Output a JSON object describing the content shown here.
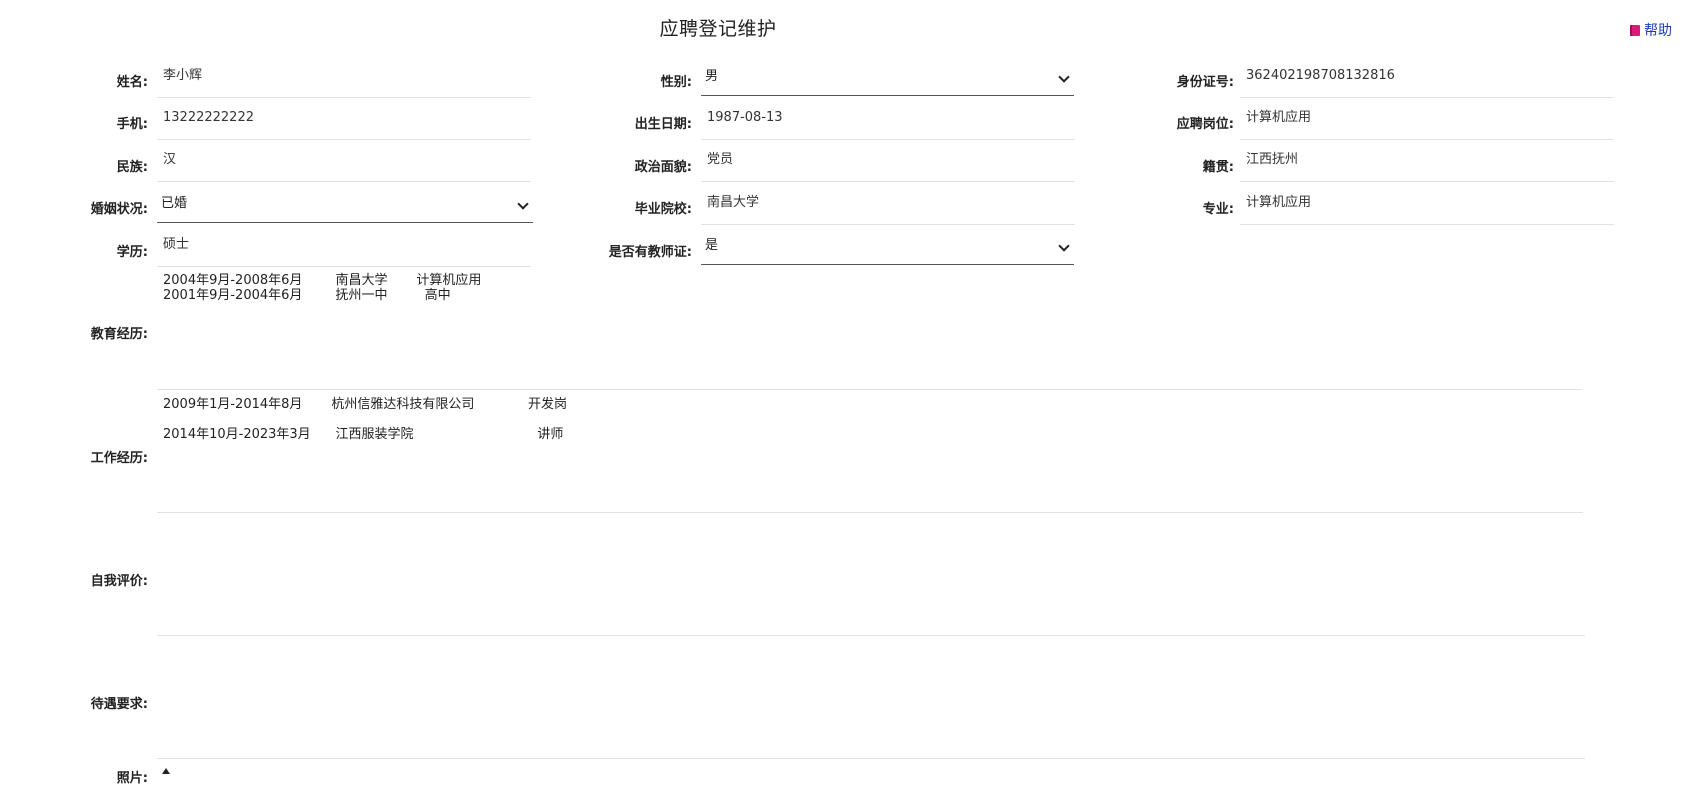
{
  "header": {
    "title": "应聘登记维护",
    "help_label": "帮助"
  },
  "fields": {
    "name": {
      "label": "姓名:",
      "value": "李小辉"
    },
    "gender": {
      "label": "性别:",
      "value": "男"
    },
    "id_card": {
      "label": "身份证号:",
      "value": "362402198708132816"
    },
    "phone": {
      "label": "手机:",
      "value": "13222222222"
    },
    "birth_date": {
      "label": "出生日期:",
      "value": "1987-08-13"
    },
    "position": {
      "label": "应聘岗位:",
      "value": "计算机应用"
    },
    "ethnicity": {
      "label": "民族:",
      "value": "汉"
    },
    "political": {
      "label": "政治面貌:",
      "value": "党员"
    },
    "native_place": {
      "label": "籍贯:",
      "value": "江西抚州"
    },
    "marital": {
      "label": "婚姻状况:",
      "value": "已婚"
    },
    "school": {
      "label": "毕业院校:",
      "value": "南昌大学"
    },
    "major": {
      "label": "专业:",
      "value": "计算机应用"
    },
    "education": {
      "label": "学历:",
      "value": "硕士"
    },
    "teacher_cert": {
      "label": "是否有教师证:",
      "value": "是"
    },
    "edu_history": {
      "label": "教育经历:",
      "lines": [
        "2004年9月-2008年6月        南昌大学       计算机应用",
        "2001年9月-2004年6月        抚州一中         高中"
      ]
    },
    "work_history": {
      "label": "工作经历:",
      "lines": [
        "2009年1月-2014年8月       杭州信雅达科技有限公司             开发岗",
        "2014年10月-2023年3月      江西服装学院                              讲师"
      ]
    },
    "self_eval": {
      "label": "自我评价:",
      "value": ""
    },
    "salary": {
      "label": "待遇要求:",
      "value": ""
    },
    "photo": {
      "label": "照片:"
    }
  }
}
